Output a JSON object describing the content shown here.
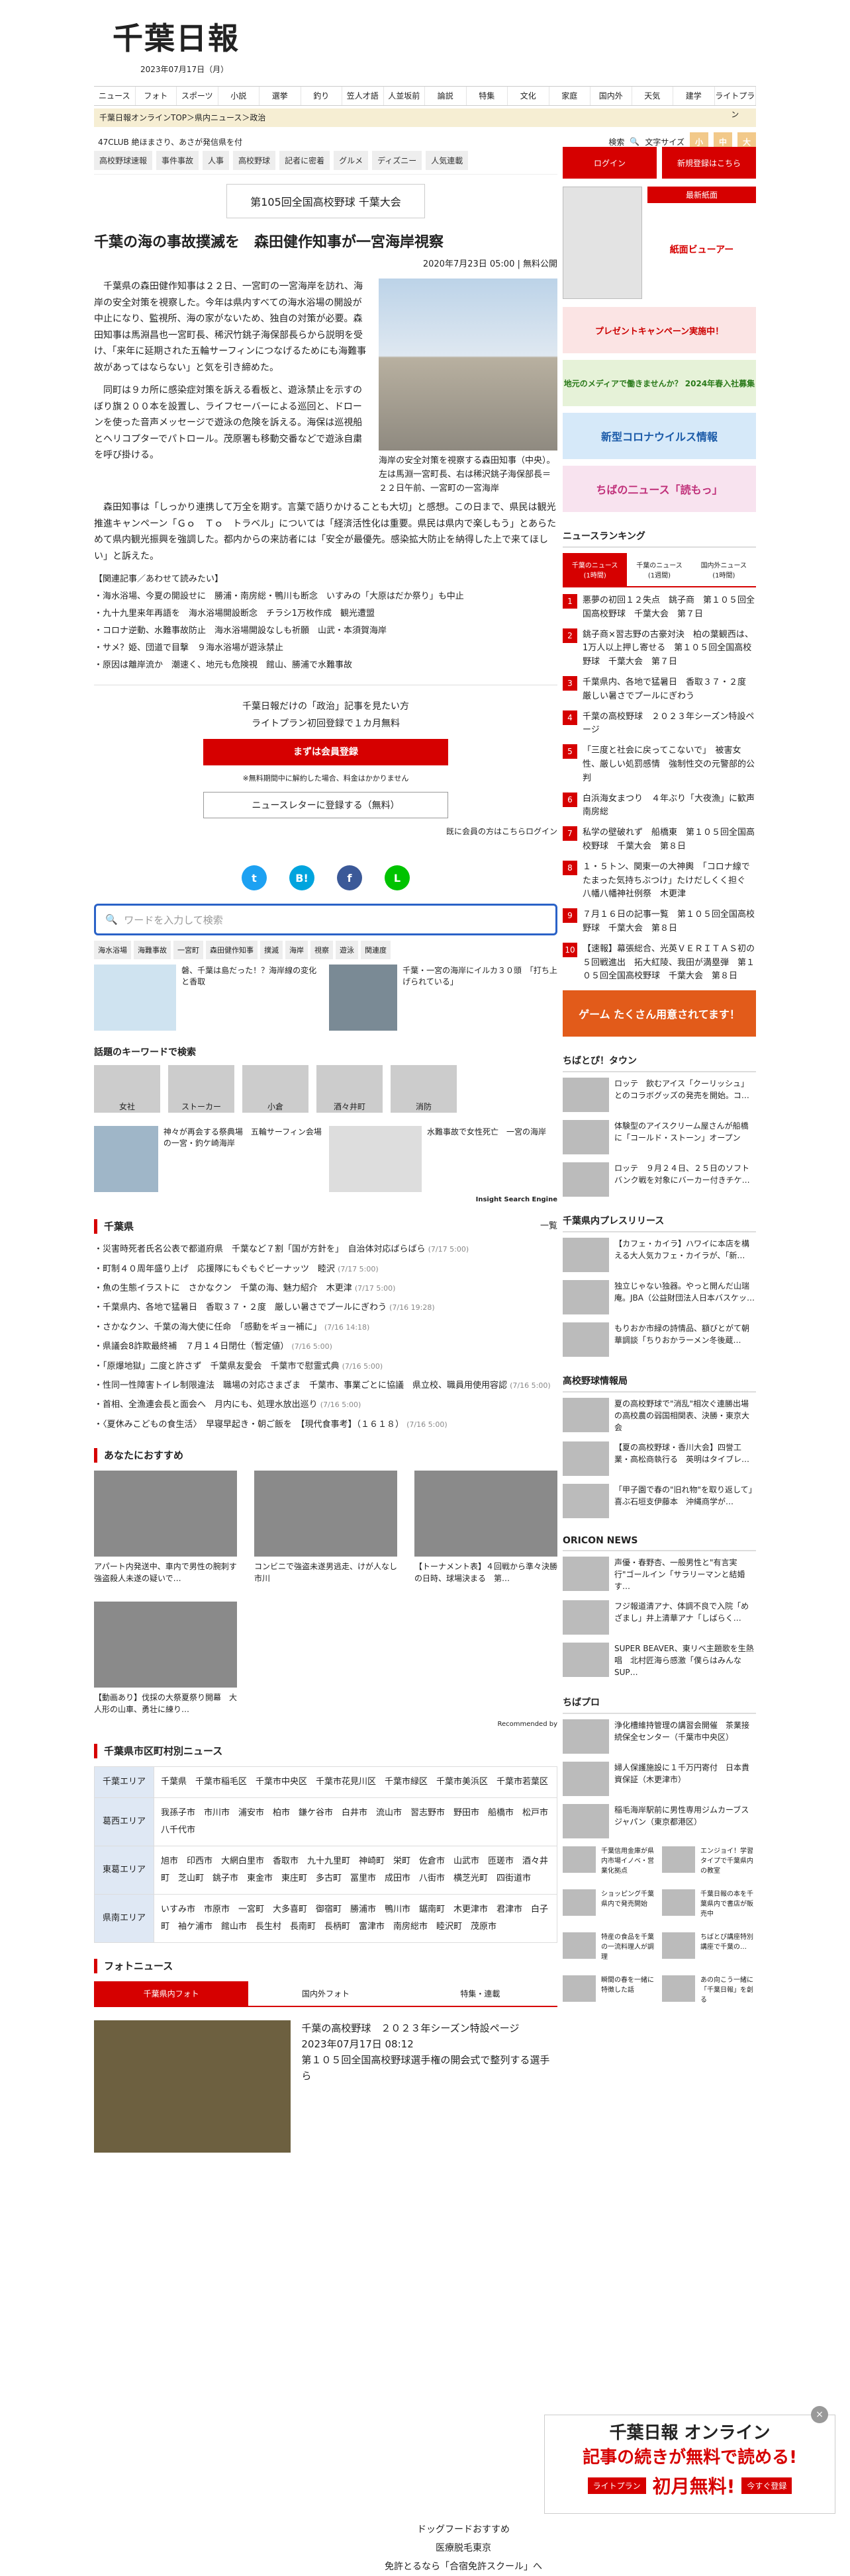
{
  "site": {
    "logo": "千葉日報",
    "date": "2023年07月17日（月）"
  },
  "gnav": [
    "ニュース",
    "フォト",
    "スポーツ",
    "小説",
    "選挙",
    "釣り",
    "笠人才語",
    "人並坂前",
    "論説",
    "特集",
    "文化",
    "家庭",
    "国内外",
    "天気",
    "建学",
    "ライトプラン"
  ],
  "crumb": "千葉日報オンラインTOP＞県内ニュース＞政治",
  "subbar": {
    "left": "47CLUB 絶ほまさり、あさが発信県を付",
    "search_label": "検索",
    "fontsize_label": "文字サイズ",
    "sizes": [
      "小",
      "中",
      "大"
    ]
  },
  "tags": [
    "高校野球速報",
    "事件事故",
    "人事",
    "高校野球",
    "記者に密着",
    "グルメ",
    "ディズニー",
    "人気連載"
  ],
  "banner": "第105回全国高校野球 千葉大会",
  "article": {
    "title": "千葉の海の事故撲滅を　森田健作知事が一宮海岸視察",
    "meta": "2020年7月23日 05:00 | 無料公開",
    "p1": "千葉県の森田健作知事は２２日、一宮町の一宮海岸を訪れ、海岸の安全対策を視察した。今年は県内すべての海水浴場の開設が中止になり、監視所、海の家がないため、独自の対策が必要。森田知事は馬淵昌也一宮町長、稀沢竹銚子海保部長らから説明を受け、「来年に延期された五輪サーフィンにつなげるためにも海難事故があってはならない」と気を引き締めた。",
    "p2": "同町は９カ所に感染症対策を訴える看板と、遊泳禁止を示すのぼり旗２００本を設置し、ライフセーバーによる巡回と、ドローンを使った音声メッセージで遊泳の危険を訴える。海保は巡視船とヘリコプターでパトロール。茂原署も移動交番などで遊泳自粛を呼び掛ける。",
    "p3": "森田知事は「しっかり連携して万全を期す。言葉で語りかけることも大切」と感想。この日まで、県民は観光推進キャンペーン「Ｇｏ　Ｔｏ　トラベル」については「経済活性化は重要。県民は県内で楽しもう」とあらためて県内観光振興を強調した。都内からの来訪者には「安全が最優先。感染拡大防止を納得した上で来てほしい」と訴えた。",
    "caption": "海岸の安全対策を視察する森田知事（中央）。左は馬淵一宮町長、右は稀沢銚子海保部長＝２２日午前、一宮町の一宮海岸",
    "related_head": "【関連記事／あわせて読みたい】",
    "related": [
      "海水浴場、今夏の開設せに　勝浦・南房総・鴨川も断念　いすみの「大原はだか祭り」も中止",
      "九十九里来年再語を　海水浴場開設断念　チラシ1万枚作成　観光遭盟",
      "コロナ逆動、水難事故防止　海水浴場開設なしも祈願　山武・本須賀海岸",
      "サメ？姫、団道で目撃　９海水浴場が遊泳禁止",
      "原因は離岸流か　潮速く、地元も危険視　館山、勝浦で水難事故"
    ]
  },
  "paywall": {
    "line1": "千葉日報だけの「政治」記事を見たい方",
    "line2": "ライトプラン初回登録で１カ月無料",
    "register": "まずは会員登録",
    "note": "※無料期間中に解約した場合、料金はかかりません",
    "newsletter": "ニュースレターに登録する（無料）",
    "login": "既に会員の方はこちらログイン"
  },
  "share": [
    "t",
    "B!",
    "f",
    "L"
  ],
  "search_placeholder": "ワードを入力して検索",
  "keywords": [
    "海水浴場",
    "海難事故",
    "一宮町",
    "森田健作知事",
    "撲滅",
    "海岸",
    "視察",
    "遊泳",
    "関連度"
  ],
  "cards": [
    {
      "title": "磐、千葉は島だった！？海岸線の変化と香取"
    },
    {
      "title": "千葉・一宮の海岸にイルカ３０頭　「打ち上げられている」"
    }
  ],
  "topics_head": "話題のキーワードで検索",
  "topics": [
    "女社",
    "ストーカー",
    "小倉",
    "酒々井町",
    "消防"
  ],
  "cards2": [
    {
      "title": "神々が再会する祭典場　五輪サーフィン会場の一宮・釣ケ崎海岸"
    },
    {
      "title": "水難事故で女性死亡　一宮の海岸"
    }
  ],
  "insight": "Insight Search Engine",
  "chiba": {
    "head": "千葉県",
    "more": "一覧",
    "items": [
      {
        "t": "災害時死者氏名公表で都道府県　千葉など７割「国が方針を」　自治体対応ばらばら",
        "d": "(7/17 5:00)"
      },
      {
        "t": "町制４０周年盛り上げ　応援隊にもぐもぐビーナッツ　睦沢",
        "d": "(7/17 5:00)"
      },
      {
        "t": "魚の生態イラストに　さかなクン　千葉の海、魅力紹介　木更津",
        "d": "(7/17 5:00)"
      },
      {
        "t": "千葉県内、各地で猛暑日　香取３７・２度　厳しい暑さでプールにぎわう",
        "d": "(7/16 19:28)"
      },
      {
        "t": "さかなクン、千葉の海大使に任命　「感動をギョー補に」",
        "d": "(7/16 14:18)"
      },
      {
        "t": "県議会8詐欺最終補　７月１４日閉仕（暫定値）",
        "d": "(7/16 5:00)"
      },
      {
        "t": "「原爆地獄」二度と許さず　千葉県友愛会　千葉市で慰霊式典",
        "d": "(7/16 5:00)"
      },
      {
        "t": "性同一性障害トイレ制限違法　職場の対応さまざま　千葉市、事業ごとに協議　県立校、職員用使用容認",
        "d": "(7/16 5:00)"
      },
      {
        "t": "首相、全漁連会長と面会へ　月内にも、処理水放出巡り",
        "d": "(7/16 5:00)"
      },
      {
        "t": "〈夏休みこどもの食生活〉　早寝早起き・朝ご飯を　【現代食事考】（１６１８）",
        "d": "(7/16 5:00)"
      }
    ]
  },
  "recommend": {
    "head": "あなたにおすすめ",
    "items": [
      "アパート内発送中、車内で男性の腕刺す　強盗殺人未遂の疑いで…",
      "コンビニで強盗未遂男逃走、けが人なし　市川",
      "【トーナメント表】４回戦から準々決勝の日時、球場決まる　第…",
      "【動画あり】伐採の大祭夏祭り開幕　大人形の山車、勇壮に練り…"
    ],
    "credit": "Recommended by"
  },
  "area": {
    "head": "千葉県市区町村別ニュース",
    "rows": [
      {
        "h": "千葉エリア",
        "v": "千葉県　千葉市稲毛区　千葉市中央区　千葉市花見川区　千葉市緑区　千葉市美浜区　千葉市若葉区"
      },
      {
        "h": "葛西エリア",
        "v": "我孫子市　市川市　浦安市　柏市　鎌ケ谷市　白井市　流山市　習志野市　野田市　船橋市　松戸市　八千代市"
      },
      {
        "h": "東葛エリア",
        "v": "旭市　印西市　大網白里市　香取市　九十九里町　神崎町　栄町　佐倉市　山武市　匝瑳市　酒々井町　芝山町　銚子市　東金市　東庄町　多古町　冨里市　成田市　八街市　横芝光町　四街道市"
      },
      {
        "h": "県南エリア",
        "v": "いすみ市　市原市　一宮町　大多喜町　御宿町　勝浦市　鴨川市　鋸南町　木更津市　君津市　白子町　袖ケ浦市　館山市　長生村　長南町　長柄町　富津市　南房総市　睦沢町　茂原市"
      }
    ]
  },
  "photonews": {
    "head": "フォトニュース",
    "tabs": [
      "千葉県内フォト",
      "国内外フォト",
      "特集・連載"
    ],
    "title": "千葉の高校野球　２０２３年シーズン特設ページ",
    "date": "2023年07月17日 08:12",
    "sub": "第１０５回全国高校野球選手権の開会式で整列する選手ら"
  },
  "side": {
    "login": "ログイン",
    "member": "新規登録はこちら",
    "latest": "最新紙面",
    "viewer": "紙面ビューアー",
    "ads": [
      "プレゼントキャンペーン実施中！",
      "地元のメディアで働きませんか？ 2024年春入社募集",
      "新型コロナウイルス情報",
      "ちばの二ュース「読もっ」"
    ],
    "ranking_head": "ニュースランキング",
    "rank_tabs": [
      "千葉のニュース(1時間)",
      "千葉のニュース(1週間)",
      "国内外ニュース(1時間)"
    ],
    "ranking": [
      "悪夢の初回１２失点　銚子商　第１０５回全国高校野球　千葉大会　第７日",
      "銚子商×習志野の古豪対決　柏の葉観西は、1万人以上押し寄せる　第１０５回全国高校野球　千葉大会　第７日",
      "千葉県内、各地で猛暑日　香取３７・２度　厳しい暑さでプールにぎわう",
      "千葉の高校野球　２０２３年シーズン特設ページ",
      "「三度と社会に戻ってこないで」　被害女性、厳しい処罰感情　強制性交の元警部的公判",
      "白浜海女まつり　４年ぶり「大夜漁」に歓声　南房総",
      "私学の壁破れず　船橋東　第１０５回全国高校野球　千葉大会　第８日",
      "１・５トン、関東一の大神輿　「コロナ線でたまった気持ちぶつけ」たけだしくく担ぐ　八幡八幡神社例祭　木更津",
      "７月１６日の記事一覧　第１０５回全国高校野球　千葉大会　第８日",
      "【速報】幕張総合、光英ＶＥＲＩＴＡＳ初の５回戦進出　拓大紅陵、我田が満塁弾　第１０５回全国高校野球　千葉大会　第８日"
    ],
    "game_ad": "ゲーム たくさん用意されてます！",
    "tawn_head": "ちばとぴ！タウン",
    "tawn": [
      "ロッテ　飲むアイス「クーリッシュ」とのコラボグッズの発売を開始。コ…",
      "体験型のアイスクリーム屋さんが船橋に「コールド・ストーン」オープン",
      "ロッテ　９月２４日、２５日のソフトバンク戦を対象にバーカー付きチケ…"
    ],
    "press_head": "千葉県内プレスリリース",
    "press": [
      "【カフェ・カイラ】ハワイに本店を構える大人気カフェ・カイラが、「新…",
      "独立じゃない独器。やっと開んだ山瑞庵。JBA（公益財団法人日本バスケッ…",
      "もりおか市緑の詩情品、額びとがて朝華調談「ちりおかラーメン冬後蔵…"
    ],
    "koko_head": "高校野球情報局",
    "koko": [
      "夏の高校野球で\"消乱\"相次ぐ連勝出場の高校農の弱国相関表、決勝・東京大会",
      "【夏の高校野球・香川大会】四誉工業・高松商執行る　英明はタイブレ…",
      "「甲子園で春の\"旧れ物\"を取り返して」喜ぶ石垣支伊藤本　沖縄商学が…"
    ],
    "oricon_head": "ORICON NEWS",
    "oricon": [
      "声優・春野杏、一般男性と\"有言実行\"ゴールイン「サラリーマンと結婚す…",
      "フジ報道清アナ、体調不良で入院「めざまし」井上清華アナ「しばらく…",
      "SUPER BEAVER、東リベ主題歌を生熱唱　北村匠海ら感激「僕らはみんなSUP…"
    ],
    "chibapro_head": "ちばプロ",
    "chibapro": [
      "浄化槽維持管理の講習会開催　茶業接続保全センター（千葉市中央区）",
      "婦人保護施設に１千万円寄付　日本貴資保証（木更津市）",
      "稲毛海岸駅前に男性専用ジムカーブスジャパン（東京都港区）"
    ],
    "chibapro_grid": [
      "千葉信用金庫が県内市場イノベ・営業化拠点",
      "エンジョイ！学習タイプで千葉県内の教室",
      "ショッピング千葉県内で発売開始",
      "千葉日報の本を千葉県内で書店が販売中",
      "特産の食品を千葉の一流料理人が調理",
      "ちばとぴ講座特別講座で千葉の…",
      "瞬間の春を一緒に特徴した話",
      "あの向こう一緒に「千葉日報」を創る"
    ]
  },
  "float_ad": {
    "t1": "千葉日報 オンライン",
    "t2": "記事の続きが無料で読める!",
    "lp": "ライトプラン",
    "fr": "初月無料!",
    "go": "今すぐ登録"
  },
  "footer": [
    "ドッグフードおすすめ",
    "医療脱毛東京",
    "免許とるなら「合宿免許スクール」へ"
  ]
}
